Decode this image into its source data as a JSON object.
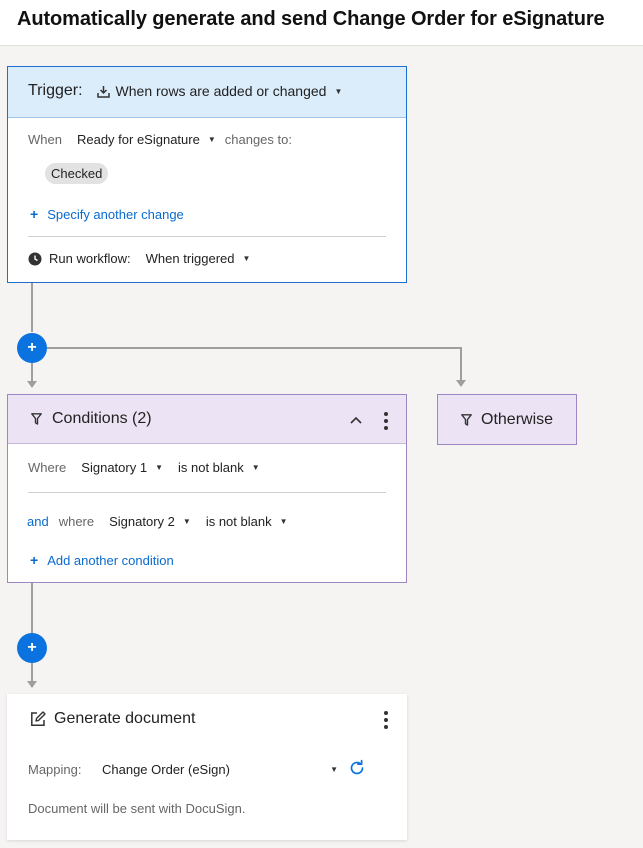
{
  "page": {
    "title": "Automatically generate and send Change Order for eSignature"
  },
  "trigger": {
    "label": "Trigger:",
    "event": "When rows are added or changed",
    "when_label": "When",
    "column": "Ready for eSignature",
    "changes_to": "changes to:",
    "value": "Checked",
    "specify_another": "Specify another change",
    "run_label": "Run workflow:",
    "run_value": "When triggered"
  },
  "conditions": {
    "title": "Conditions (2)",
    "where_label": "Where",
    "cond1_field": "Signatory 1",
    "cond1_op": "is not blank",
    "and_label": "and",
    "where2_label": "where",
    "cond2_field": "Signatory 2",
    "cond2_op": "is not blank",
    "add_condition": "Add another condition"
  },
  "otherwise": {
    "label": "Otherwise"
  },
  "generate": {
    "title": "Generate document",
    "mapping_label": "Mapping:",
    "mapping_value": "Change Order (eSign)",
    "note": "Document will be sent with DocuSign."
  },
  "colors": {
    "trigger_header": "#dbecfb",
    "trigger_border": "#1f6fcf",
    "condition_header": "#ece4f5",
    "condition_border": "#9c86c4",
    "accent": "#0b73e0"
  }
}
